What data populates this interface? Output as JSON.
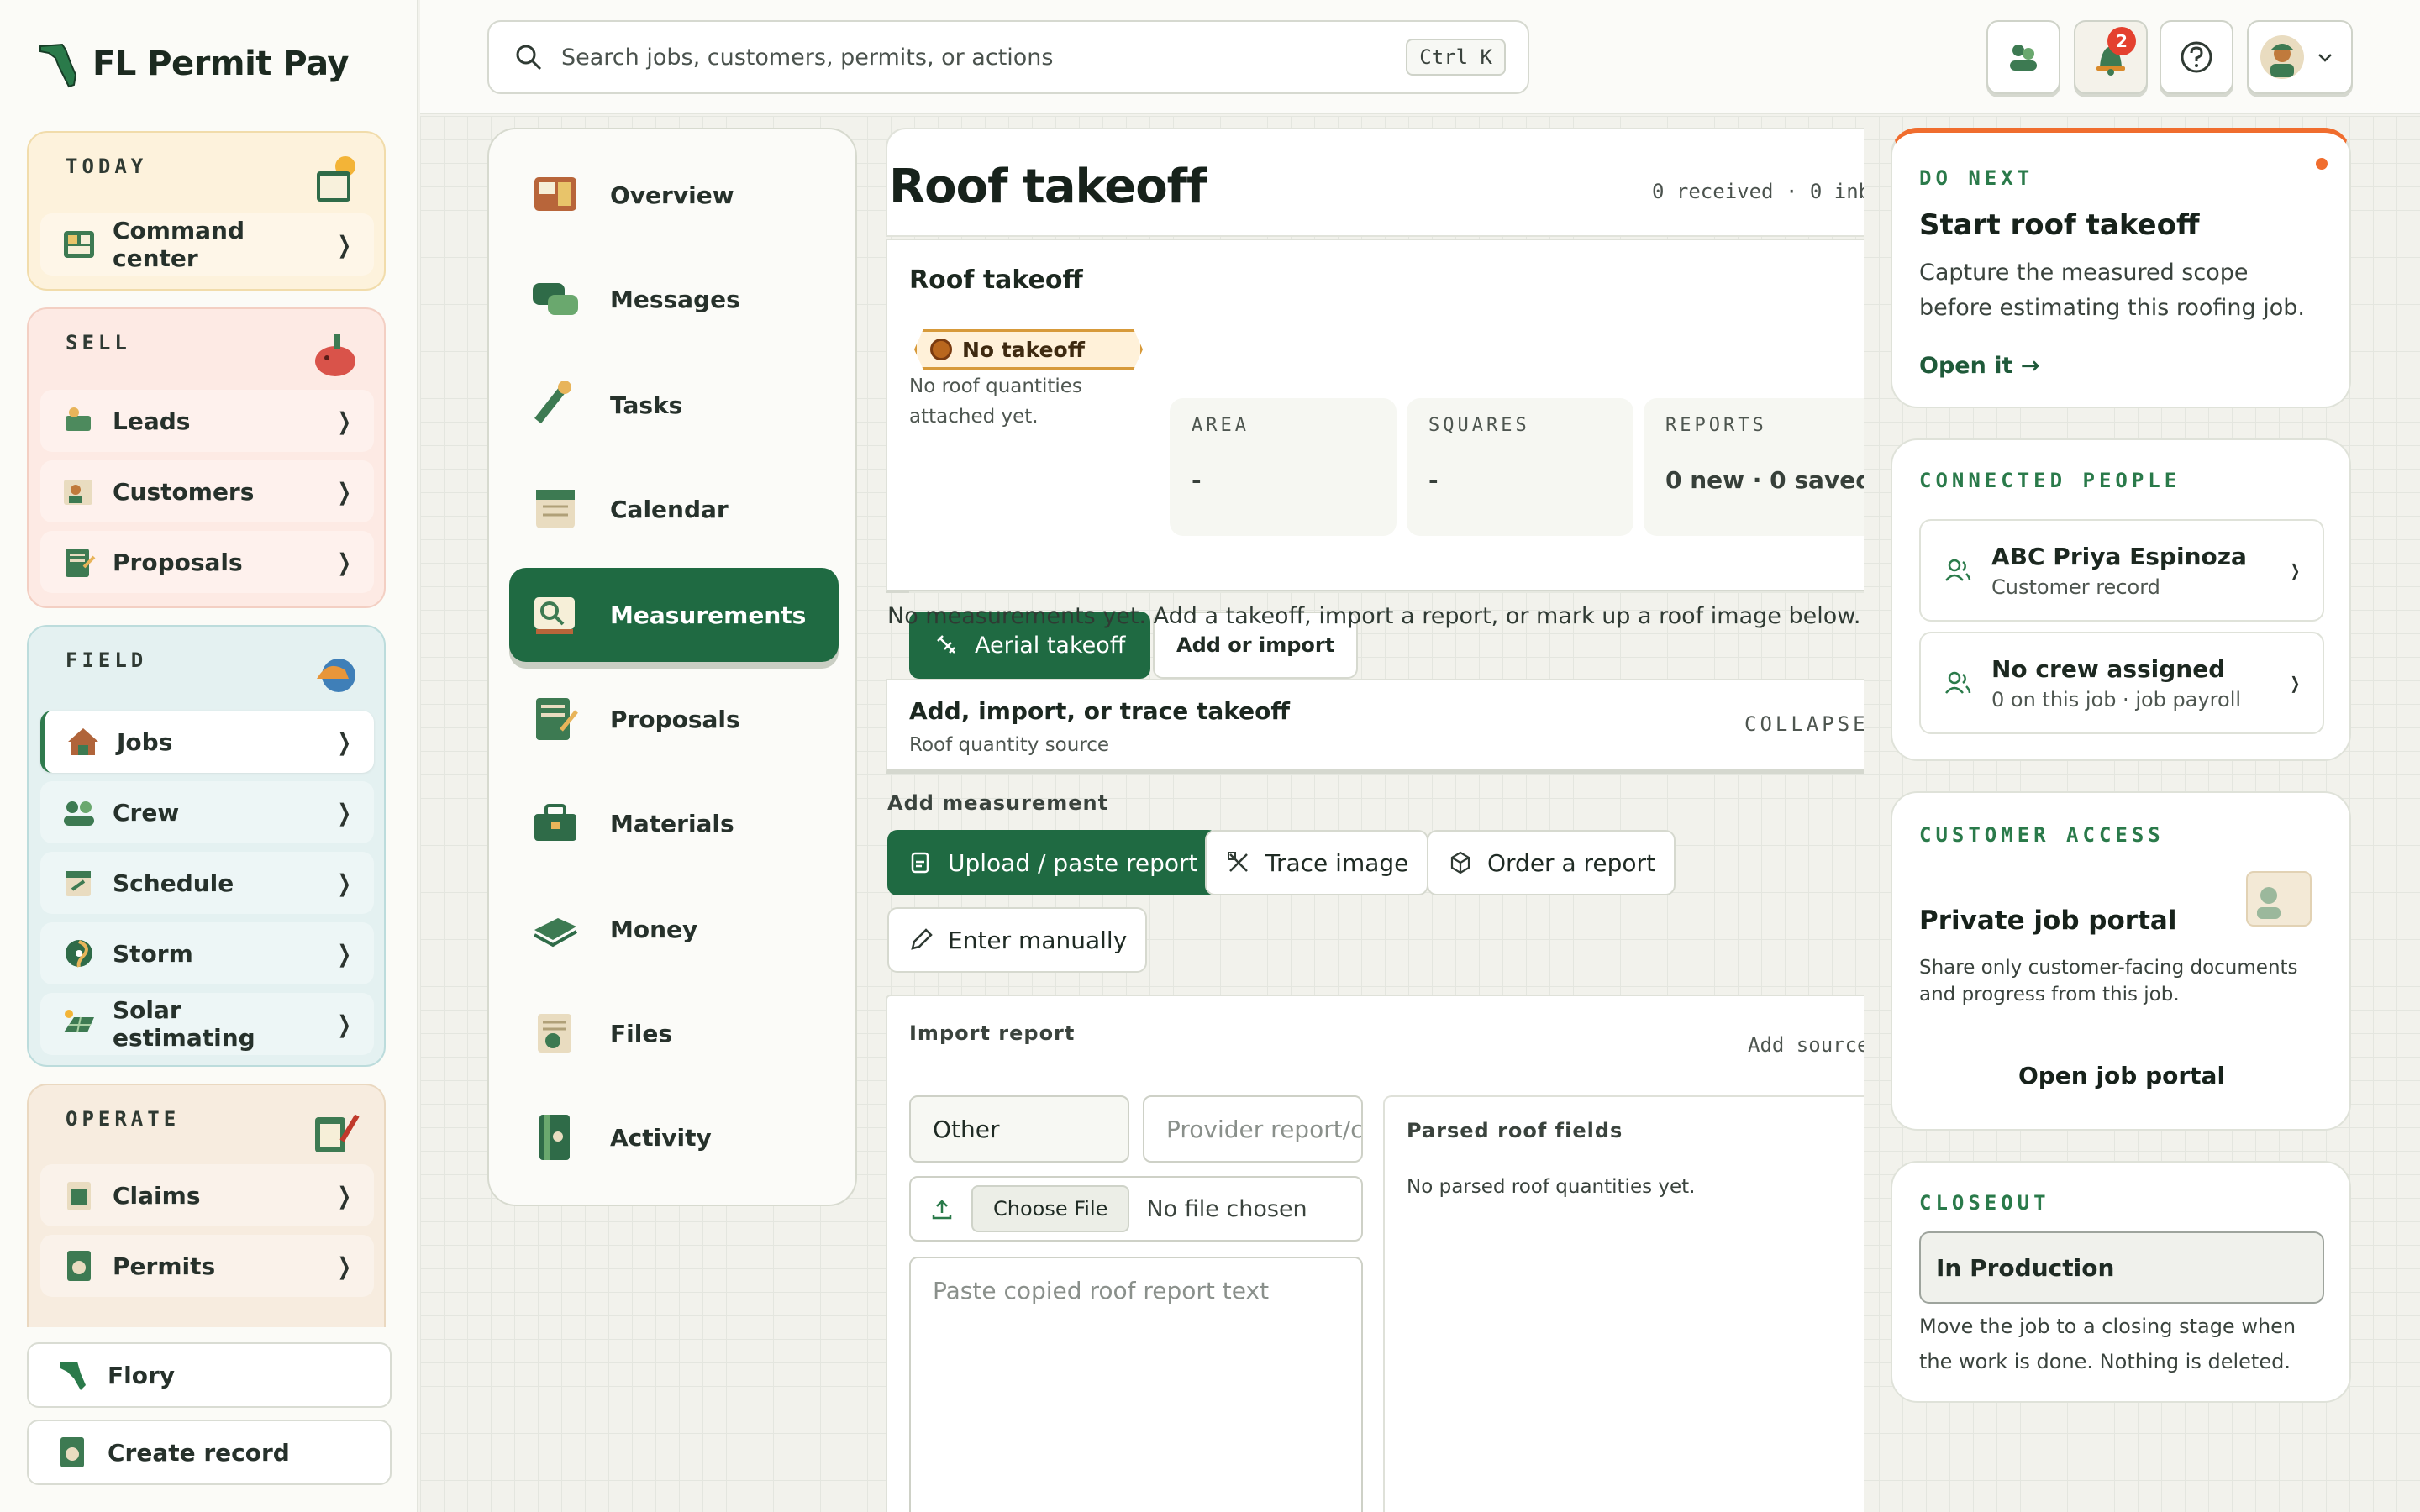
{
  "brand": {
    "name": "FL Permit Pay"
  },
  "sidebar": {
    "groups": [
      {
        "title": "TODAY",
        "items": [
          {
            "label": "Command center"
          }
        ]
      },
      {
        "title": "SELL",
        "items": [
          {
            "label": "Leads"
          },
          {
            "label": "Customers"
          },
          {
            "label": "Proposals"
          }
        ]
      },
      {
        "title": "FIELD",
        "items": [
          {
            "label": "Jobs",
            "active": true
          },
          {
            "label": "Crew"
          },
          {
            "label": "Schedule"
          },
          {
            "label": "Storm"
          },
          {
            "label": "Solar estimating"
          }
        ]
      },
      {
        "title": "OPERATE",
        "items": [
          {
            "label": "Claims"
          },
          {
            "label": "Permits"
          }
        ]
      }
    ],
    "bottom": {
      "flory": "Flory",
      "create": "Create record"
    }
  },
  "topbar": {
    "search_placeholder": "Search jobs, customers, permits, or actions",
    "shortcut": "Ctrl K",
    "notification_count": "2"
  },
  "section_nav": {
    "items": [
      "Overview",
      "Messages",
      "Tasks",
      "Calendar",
      "Measurements",
      "Proposals",
      "Materials",
      "Money",
      "Files",
      "Activity"
    ],
    "active": "Measurements"
  },
  "main": {
    "title": "Roof takeoff",
    "counts": "0 received · 0 inb",
    "takeoff_card": {
      "title": "Roof takeoff",
      "tag": "No takeoff",
      "note": "No roof quantities attached yet.",
      "stats": [
        {
          "label": "AREA",
          "value": "-"
        },
        {
          "label": "SQUARES",
          "value": "-"
        },
        {
          "label": "REPORTS",
          "value": "0 new · 0 saved"
        }
      ],
      "aerial_btn": "Aerial takeoff",
      "add_btn": "Add or import"
    },
    "empty_msg": "No measurements yet. Add a takeoff, import a report, or mark up a roof image below.",
    "source_card": {
      "title": "Add, import, or trace takeoff",
      "subtitle": "Roof quantity source",
      "collapse": "COLLAPSE"
    },
    "add_measurement": {
      "label": "Add measurement",
      "buttons": [
        "Upload / paste report",
        "Trace image",
        "Order a report",
        "Enter manually"
      ]
    },
    "import": {
      "title": "Import report",
      "add_source": "Add source",
      "provider_value": "Other",
      "provider_placeholder": "Provider report/c",
      "choose_file": "Choose File",
      "no_file": "No file chosen",
      "paste_placeholder": "Paste copied roof report text",
      "parsed_title": "Parsed roof fields",
      "parsed_empty": "No parsed roof quantities yet."
    }
  },
  "right": {
    "do_next": {
      "title": "DO NEXT",
      "heading": "Start roof takeoff",
      "body": "Capture the measured scope before estimating this roofing job.",
      "link": "Open it →"
    },
    "connected": {
      "title": "CONNECTED PEOPLE",
      "people": [
        {
          "name": "ABC Priya Espinoza",
          "sub": "Customer record"
        },
        {
          "name": "No crew assigned",
          "sub": "0 on this job · job payroll"
        }
      ]
    },
    "access": {
      "title": "CUSTOMER ACCESS",
      "heading": "Private job portal",
      "body": "Share only customer-facing documents and progress from this job.",
      "button": "Open job portal"
    },
    "closeout": {
      "title": "CLOSEOUT",
      "stage": "In Production",
      "body": "Move the job to a closing stage when the work is done. Nothing is deleted."
    }
  },
  "colors": {
    "brand_green": "#1f6a42",
    "accent_orange": "#f06d2e",
    "badge_red": "#e4412f"
  }
}
